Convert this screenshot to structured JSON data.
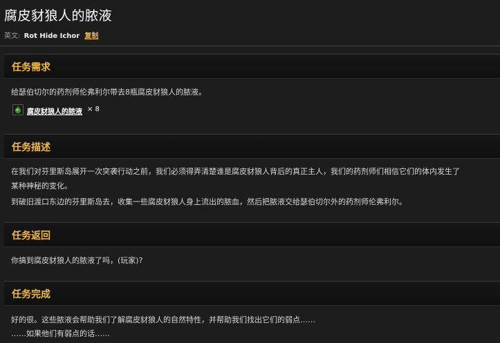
{
  "header": {
    "title": "腐皮豺狼人的脓液",
    "english_label": "英文:",
    "english_name": "Rot Hide Ichor",
    "copy_label": "复制"
  },
  "sections": {
    "requirements": {
      "heading": "任务需求",
      "text": "给瑟伯切尔的药剂师伦弗利尔带去8瓶腐皮豺狼人的脓液。",
      "item_name": "腐皮豺狼人的脓液",
      "item_qty": "× 8",
      "item_icon": "green-potion-icon"
    },
    "description": {
      "heading": "任务描述",
      "line1": "在我们对芬里斯岛展开一次突袭行动之前，我们必须得弄清楚谁是腐皮豺狼人背后的真正主人，我们的药剂师们相信它们的体内发生了",
      "line2": "某种神秘的变化。",
      "line3": "到破旧渡口东边的芬里斯岛去，收集一些腐皮豺狼人身上流出的脓血，然后把脓液交给瑟伯切尔外的药剂师伦弗利尔。"
    },
    "progress": {
      "heading": "任务返回",
      "text": "你搞到腐皮豺狼人的脓液了吗，(玩家)?"
    },
    "completion": {
      "heading": "任务完成",
      "line1": "好的很。这些脓液会帮助我们了解腐皮豺狼人的自然特性，并帮助我们找出它们的弱点……",
      "line2": "……如果他们有弱点的话……"
    }
  },
  "colors": {
    "heading": "#f5b93a",
    "copy_link": "#f0b43c",
    "background": "#1d1d1d"
  }
}
